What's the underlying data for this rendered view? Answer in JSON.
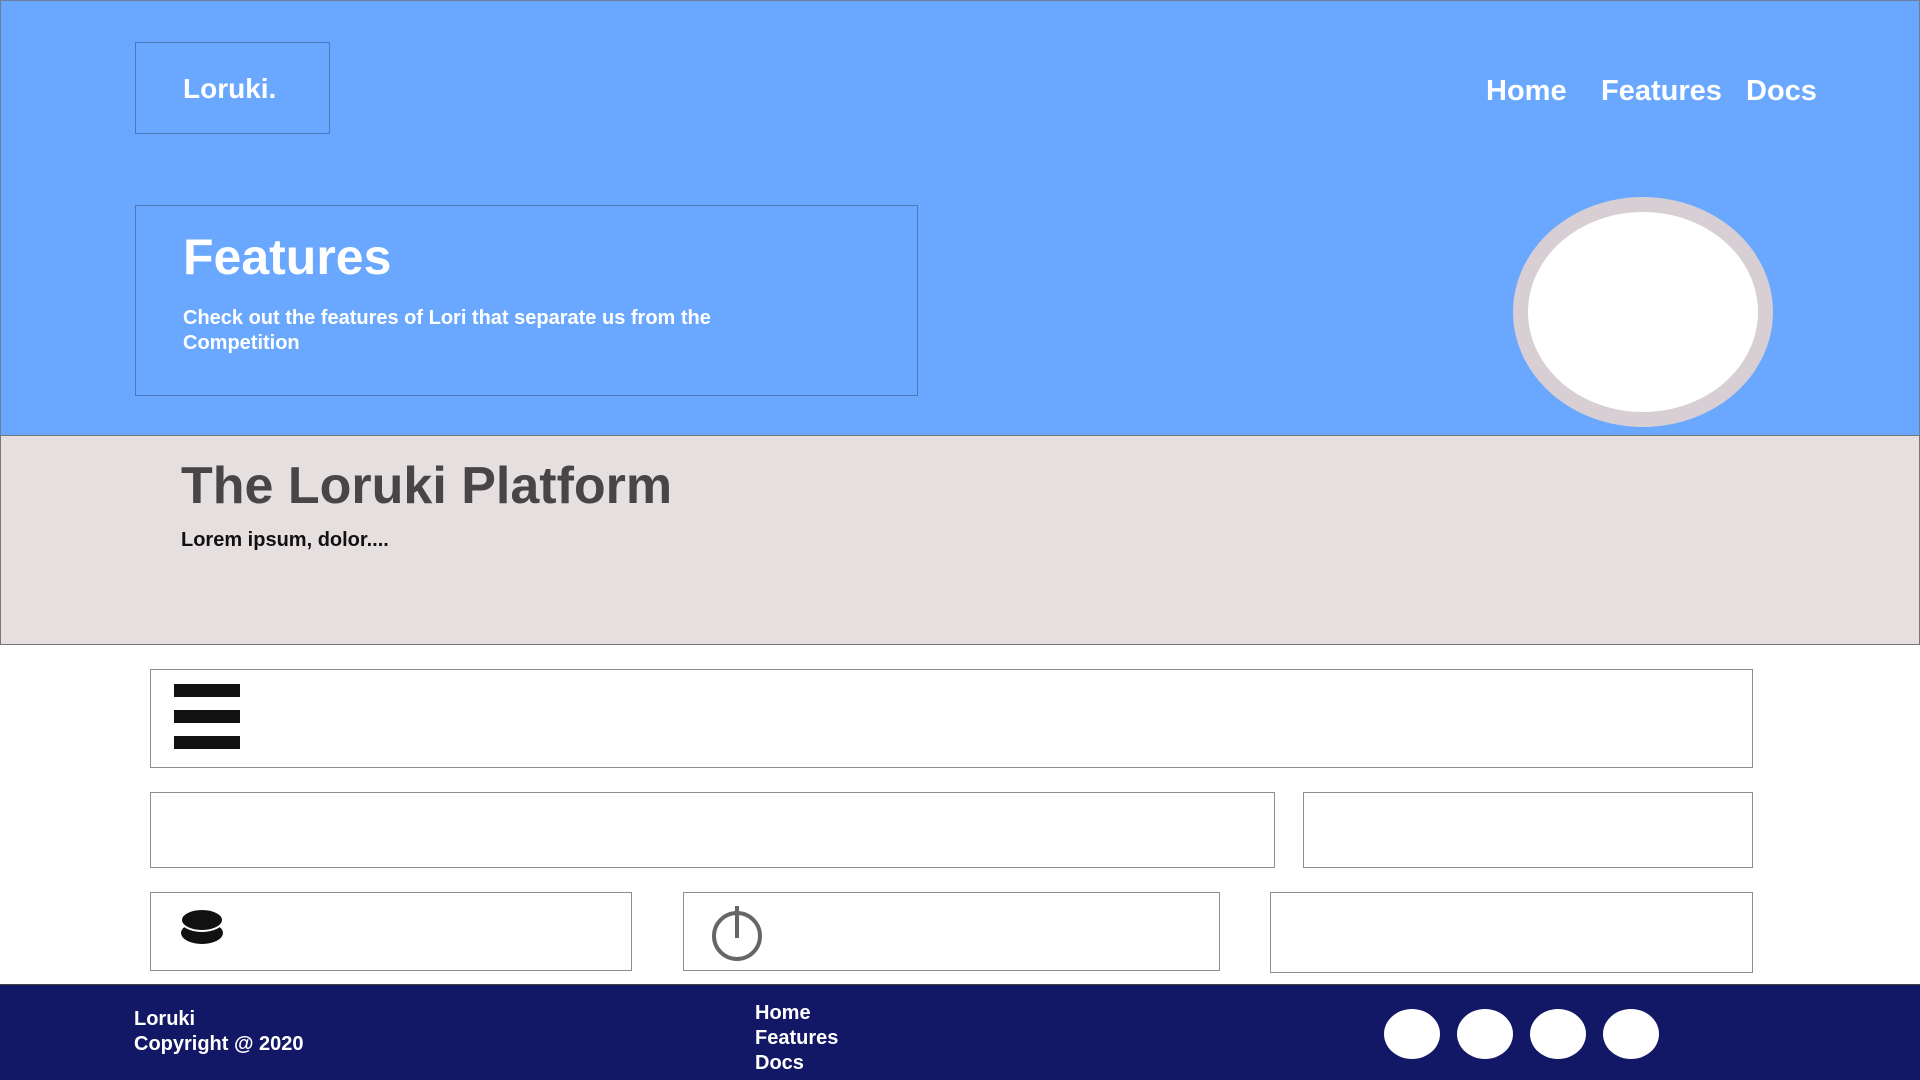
{
  "header": {
    "logo": "Loruki.",
    "nav": [
      "Home",
      "Features",
      "Docs"
    ]
  },
  "hero": {
    "title": "Features",
    "description": "Check out the features of Lori that separate us from the Competition",
    "image_icon": "circle-placeholder"
  },
  "platform": {
    "title": "The Loruki Platform",
    "subtitle": "Lorem ipsum, dolor...."
  },
  "cards": {
    "icons": [
      "menu-icon",
      "database-icon",
      "power-icon"
    ]
  },
  "footer": {
    "brand": "Loruki",
    "copyright": "Copyright @ 2020",
    "links": [
      "Home",
      "Features",
      "Docs"
    ],
    "social_icons": [
      "social-icon-1",
      "social-icon-2",
      "social-icon-3",
      "social-icon-4"
    ]
  },
  "colors": {
    "hero_bg": "#69a8fe",
    "platform_bg": "#e5dfe0",
    "footer_bg": "#131866"
  }
}
